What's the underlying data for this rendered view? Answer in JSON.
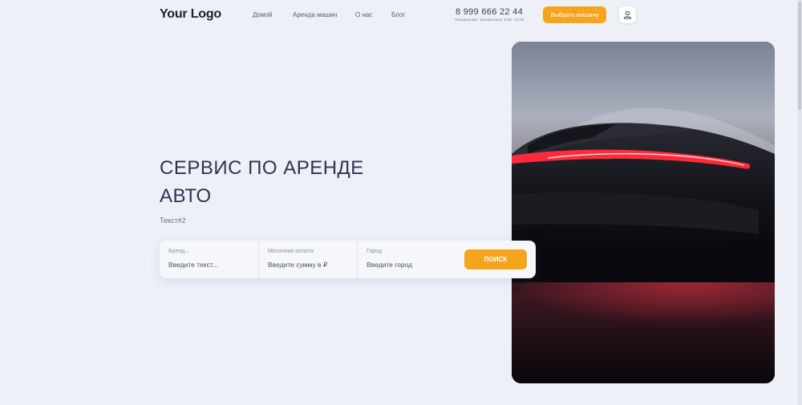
{
  "header": {
    "logo": "Your Logo",
    "nav": [
      "Домой",
      "Аренда машин",
      "О нас",
      "Блог"
    ],
    "phone": "8 999 666 22 44",
    "hours": "Понедельник - Воскресенье: 9:00 - 21:00",
    "cta_label": "Выбрать машину",
    "user_icon": "user-icon"
  },
  "hero": {
    "title_line1": "СЕРВИС ПО АРЕНДЕ",
    "title_line2": "АВТО",
    "subtitle": "Текст#2"
  },
  "search": {
    "brand_label": "Бренд...",
    "brand_placeholder": "Введите текст...",
    "payment_label": "Месячная оплата",
    "payment_placeholder": "Введите сумму в ₽",
    "city_label": "Город",
    "city_placeholder": "Введите город",
    "button_label": "ПОИСК"
  },
  "colors": {
    "accent": "#f5a51d",
    "background": "#eef0f8",
    "title": "#2e3350"
  }
}
